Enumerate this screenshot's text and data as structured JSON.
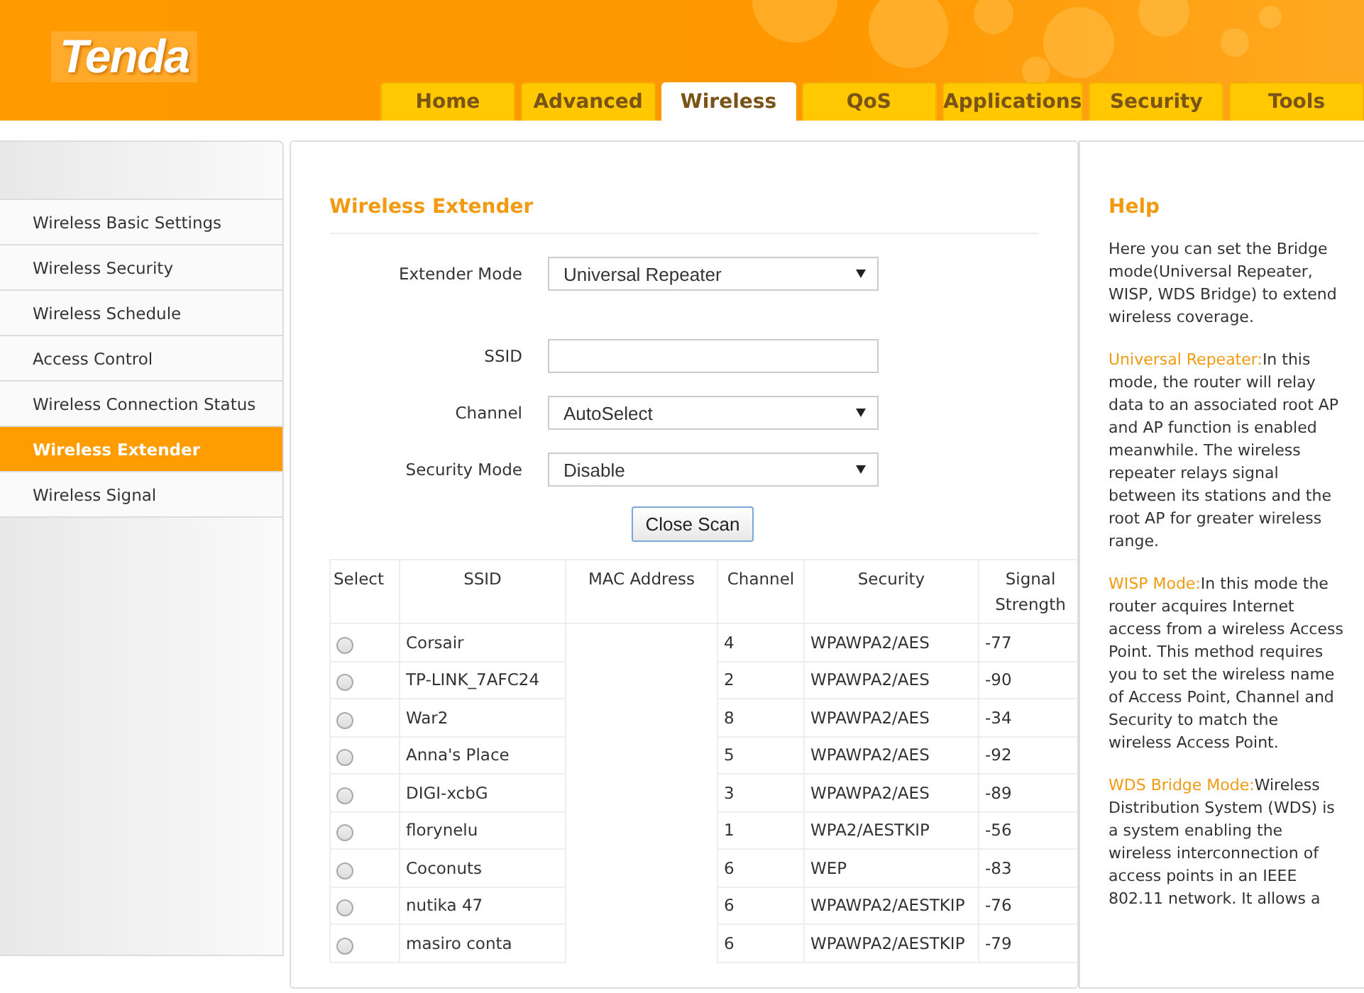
{
  "logo": "Tenda",
  "tabs": [
    {
      "label": "Home",
      "selected": false
    },
    {
      "label": "Advanced",
      "selected": false
    },
    {
      "label": "Wireless",
      "selected": true
    },
    {
      "label": "QoS",
      "selected": false
    },
    {
      "label": "Applications",
      "selected": false
    },
    {
      "label": "Security",
      "selected": false
    },
    {
      "label": "Tools",
      "selected": false
    }
  ],
  "sidebar": {
    "items": [
      {
        "label": "Wireless Basic Settings",
        "selected": false
      },
      {
        "label": "Wireless Security",
        "selected": false
      },
      {
        "label": "Wireless Schedule",
        "selected": false
      },
      {
        "label": "Access Control",
        "selected": false
      },
      {
        "label": "Wireless Connection Status",
        "selected": false
      },
      {
        "label": "Wireless Extender",
        "selected": true
      },
      {
        "label": "Wireless Signal",
        "selected": false
      }
    ]
  },
  "form": {
    "title": "Wireless Extender",
    "fields": [
      {
        "kind": "select",
        "label": "Extender Mode",
        "value": "Universal Repeater"
      },
      {
        "kind": "text",
        "label": "SSID"
      },
      {
        "kind": "select",
        "label": "Channel",
        "value": "AutoSelect"
      },
      {
        "kind": "select",
        "label": "Security Mode",
        "value": "Disable"
      }
    ],
    "button": "Close Scan"
  },
  "table": {
    "columns": [
      "Select",
      "SSID",
      "MAC Address",
      "Channel",
      "Security",
      "Signal Strength"
    ],
    "rows": [
      {
        "selected": false,
        "ssid": "Corsair",
        "channel": "4",
        "security": "WPAWPA2/AES",
        "signal": "-77"
      },
      {
        "selected": false,
        "ssid": "TP-LINK_7AFC24",
        "channel": "2",
        "security": "WPAWPA2/AES",
        "signal": "-90"
      },
      {
        "selected": false,
        "ssid": "War2",
        "channel": "8",
        "security": "WPAWPA2/AES",
        "signal": "-34"
      },
      {
        "selected": false,
        "ssid": "Anna's Place",
        "channel": "5",
        "security": "WPAWPA2/AES",
        "signal": "-92"
      },
      {
        "selected": false,
        "ssid": "DIGI-xcbG",
        "channel": "3",
        "security": "WPAWPA2/AES",
        "signal": "-89"
      },
      {
        "selected": false,
        "ssid": "florynelu",
        "channel": "1",
        "security": "WPA2/AESTKIP",
        "signal": "-56"
      },
      {
        "selected": false,
        "ssid": "Coconuts",
        "channel": "6",
        "security": "WEP",
        "signal": "-83"
      },
      {
        "selected": false,
        "ssid": "nutika 47",
        "channel": "6",
        "security": "WPAWPA2/AESTKIP",
        "signal": "-76"
      },
      {
        "selected": false,
        "ssid": "masiro conta",
        "channel": "6",
        "security": "WPAWPA2/AESTKIP",
        "signal": "-79"
      }
    ]
  },
  "help": {
    "title": "Help",
    "paragraphs": [
      {
        "text": "Here you can set the Bridge mode(Universal Repeater, WISP, WDS Bridge) to extend wireless coverage."
      },
      {
        "term": "Universal Repeater:",
        "text": "In this mode, the router will relay data to an associated root AP and AP function is enabled meanwhile. The wireless repeater relays signal between its stations and the root AP for greater wireless range."
      },
      {
        "term": "WISP Mode:",
        "text": "In this mode the router acquires Internet access from a wireless Access Point. This method requires you to set the wireless name of Access Point, Channel and Security to match the wireless Access Point."
      },
      {
        "term": "WDS Bridge Mode:",
        "text": "Wireless Distribution System (WDS) is a system enabling the wireless interconnection of access points in an IEEE 802.11 network. It allows a"
      }
    ]
  }
}
